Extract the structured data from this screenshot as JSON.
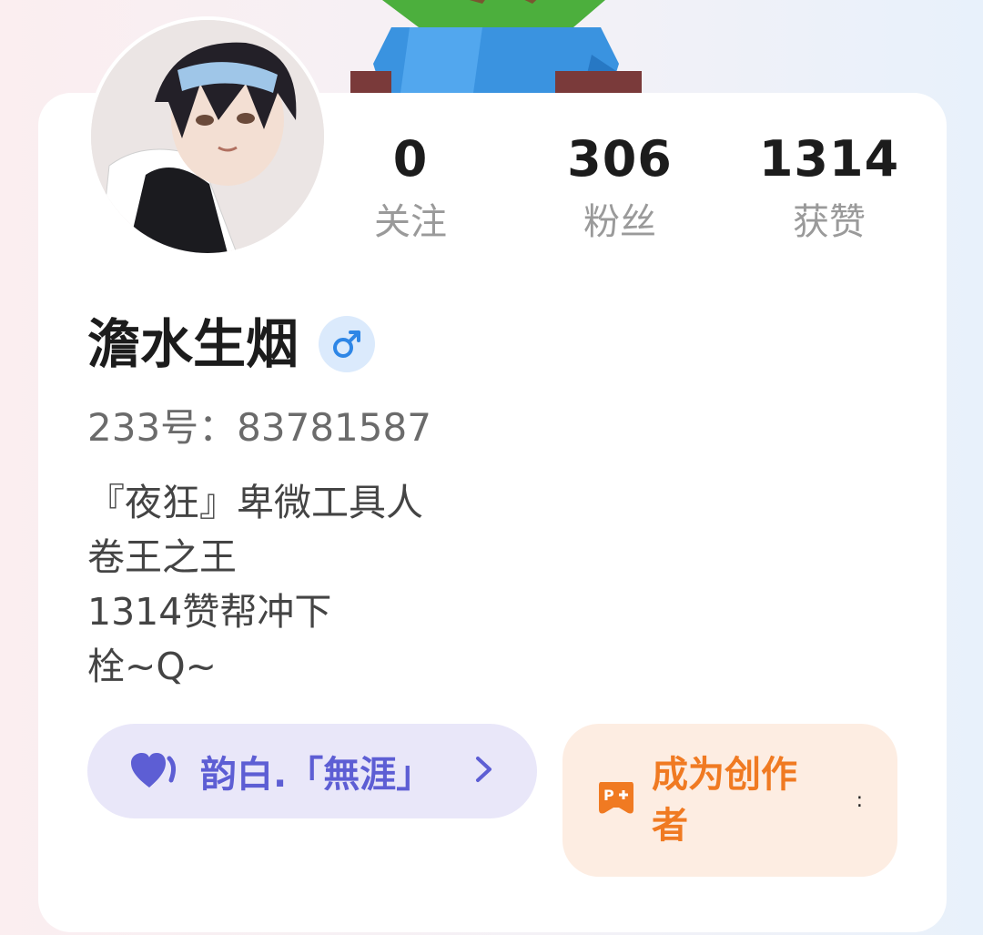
{
  "profile": {
    "name": "澹水生烟",
    "gender_icon": "♂",
    "uid": "233号：83781587",
    "bio": [
      "『夜狂』卑微工具人",
      "卷王之王",
      "1314赞帮冲下",
      "栓~Q~"
    ]
  },
  "stats": [
    {
      "value": "0",
      "label": "关注"
    },
    {
      "value": "306",
      "label": "粉丝"
    },
    {
      "value": "1314",
      "label": "获赞"
    }
  ],
  "guild": {
    "label": "韵白.「無涯」",
    "icon": "heart-icon",
    "chevron": "›"
  },
  "creator": {
    "label": "成为创作者",
    "icon": "gamepad-icon",
    "trailing": ":"
  },
  "colors": {
    "guild_text": "#5d5ed4",
    "guild_bg": "#e9e7f9",
    "creator_text": "#f07a22",
    "creator_bg": "#fdede2",
    "gender_bg": "#dbeafc",
    "gender_fg": "#2e86e6"
  }
}
